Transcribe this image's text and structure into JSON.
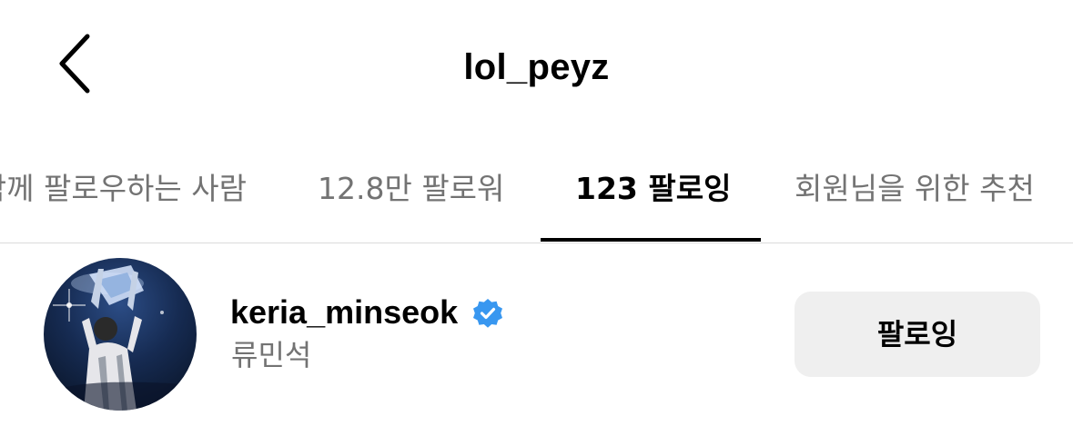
{
  "header": {
    "title": "lol_peyz",
    "back_icon": "chevron-left-icon"
  },
  "tabs": [
    {
      "label": "함께 팔로우하는 사람",
      "active": false
    },
    {
      "label": "12.8만 팔로워",
      "active": false
    },
    {
      "label": "123 팔로잉",
      "active": true
    },
    {
      "label": "회원님을 위한 추천",
      "active": false
    }
  ],
  "list": [
    {
      "username": "keria_minseok",
      "verified": true,
      "verified_icon": "verified-badge-icon",
      "full_name": "류민석",
      "button_label": "팔로잉"
    }
  ],
  "colors": {
    "text": "#000000",
    "secondary_text": "#737373",
    "verified_blue": "#3897f0",
    "button_bg": "#efefef",
    "divider": "#dbdbdb"
  }
}
